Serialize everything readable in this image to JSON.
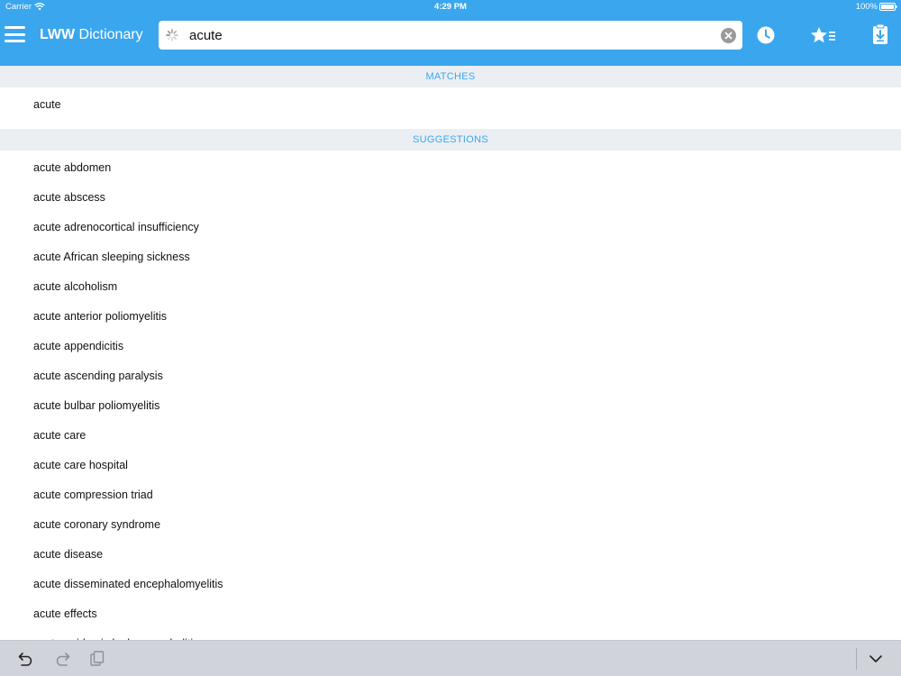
{
  "status_bar": {
    "carrier": "Carrier",
    "time": "4:29 PM",
    "battery_percent": "100%"
  },
  "header": {
    "title_brand": "LWW",
    "title_rest": " Dictionary",
    "search_value": "acute",
    "accent_color": "#3aa6ee"
  },
  "icons": {
    "menu": "hamburger-menu-icon",
    "spinner": "loading-spinner-icon",
    "clear": "clear-search-icon",
    "history": "clock-history-icon",
    "favorites": "star-list-icon",
    "download": "download-clipboard-icon",
    "undo": "undo-icon",
    "redo": "redo-icon",
    "paste": "paste-icon",
    "dismiss": "chevron-down-icon"
  },
  "matches": {
    "header": "MATCHES",
    "items": [
      "acute"
    ]
  },
  "suggestions": {
    "header": "SUGGESTIONS",
    "items": [
      "acute abdomen",
      "acute abscess",
      "acute adrenocortical insufficiency",
      "acute African sleeping sickness",
      "acute alcoholism",
      "acute anterior poliomyelitis",
      "acute appendicitis",
      "acute ascending paralysis",
      "acute bulbar poliomyelitis",
      "acute care",
      "acute care hospital",
      "acute compression triad",
      "acute coronary syndrome",
      "acute disease",
      "acute disseminated encephalomyelitis",
      "acute effects",
      "acute epidemic leukoencephalitis"
    ]
  }
}
